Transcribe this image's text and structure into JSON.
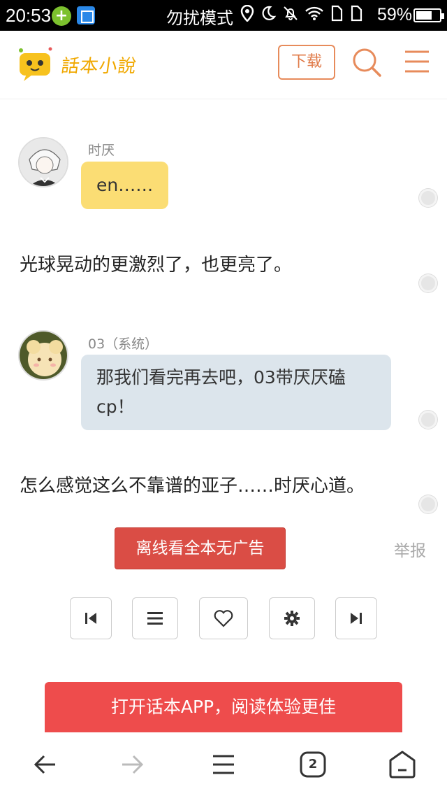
{
  "status_bar": {
    "time": "20:53",
    "mode": "勿扰模式",
    "battery": "59%"
  },
  "header": {
    "logo_text": "話本小說",
    "download_label": "下载"
  },
  "chat": [
    {
      "speaker": "时厌",
      "text": "en……"
    },
    {
      "narration": "光球晃动的更激烈了，也更亮了。"
    },
    {
      "speaker": "03（系统）",
      "text": "那我们看完再去吧，03带厌厌磕cp！"
    },
    {
      "narration": "怎么感觉这么不靠谱的亚子……时厌心道。"
    }
  ],
  "actions": {
    "offline_label": "离线看全本无广告",
    "report_label": "举报",
    "open_app_label": "打开话本APP，阅读体验更佳"
  },
  "nav": {
    "tab_count": "2"
  },
  "colors": {
    "accent_orange": "#e78b5b",
    "bubble_yellow": "#fbdd74",
    "bubble_blue": "#dce5ec",
    "cta_red": "#ee4c4c",
    "offline_red": "#da4d45"
  }
}
